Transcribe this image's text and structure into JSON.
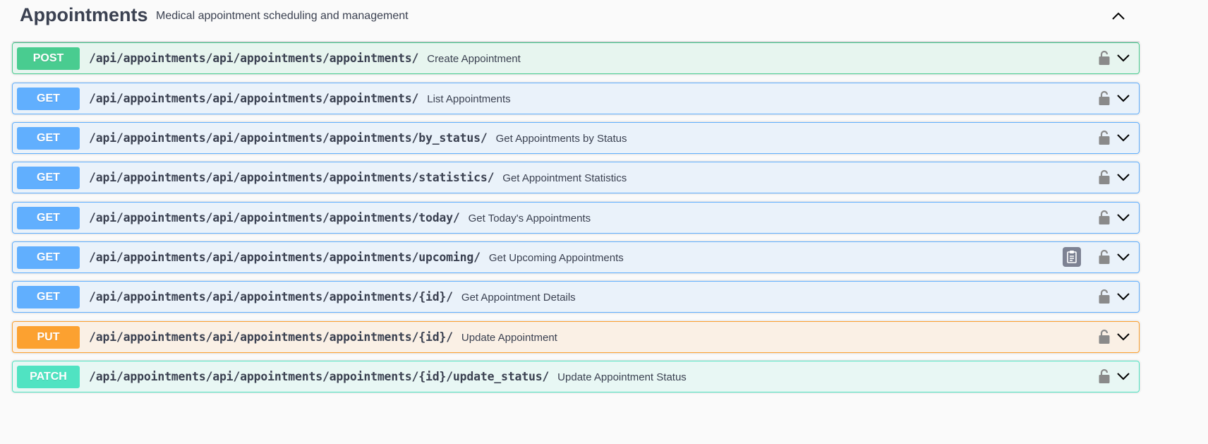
{
  "tag": {
    "title": "Appointments",
    "description": "Medical appointment scheduling and management"
  },
  "operations": [
    {
      "method": "POST",
      "path": "/api/appointments/api/appointments/appointments/",
      "summary": "Create Appointment",
      "color": "#49cc90"
    },
    {
      "method": "GET",
      "path": "/api/appointments/api/appointments/appointments/",
      "summary": "List Appointments",
      "color": "#61affe"
    },
    {
      "method": "GET",
      "path": "/api/appointments/api/appointments/appointments/by_status/",
      "summary": "Get Appointments by Status",
      "color": "#61affe"
    },
    {
      "method": "GET",
      "path": "/api/appointments/api/appointments/appointments/statistics/",
      "summary": "Get Appointment Statistics",
      "color": "#61affe"
    },
    {
      "method": "GET",
      "path": "/api/appointments/api/appointments/appointments/today/",
      "summary": "Get Today's Appointments",
      "color": "#61affe"
    },
    {
      "method": "GET",
      "path": "/api/appointments/api/appointments/appointments/upcoming/",
      "summary": "Get Upcoming Appointments",
      "color": "#61affe"
    },
    {
      "method": "GET",
      "path": "/api/appointments/api/appointments/appointments/{id}/",
      "summary": "Get Appointment Details",
      "color": "#61affe"
    },
    {
      "method": "PUT",
      "path": "/api/appointments/api/appointments/appointments/{id}/",
      "summary": "Update Appointment",
      "color": "#fca130"
    },
    {
      "method": "PATCH",
      "path": "/api/appointments/api/appointments/appointments/{id}/update_status/",
      "summary": "Update Appointment Status",
      "color": "#50e3c2"
    }
  ],
  "icons": {
    "collapse": "chevron-up-icon",
    "expand": "chevron-down-icon",
    "auth": "lock-icon",
    "copy": "copy-to-clipboard-icon"
  }
}
